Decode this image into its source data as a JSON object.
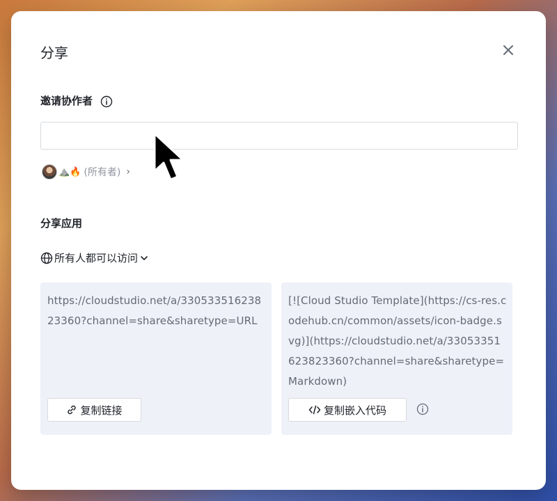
{
  "dialog": {
    "title": "分享",
    "invite": {
      "label": "邀请协作者",
      "input_value": "",
      "owner_emojis": "⛰️🔥",
      "owner_label": "(所有者)",
      "owner_chevron": "›"
    },
    "share_app": {
      "label": "分享应用",
      "access_label": "所有人都可以访问",
      "link_text": "https://cloudstudio.net/a/33053351623823360?channel=share&sharetype=URL",
      "copy_link_label": "复制链接",
      "embed_text": "[![Cloud Studio Template](https://cs-res.codehub.cn/common/assets/icon-badge.svg)](https://cloudstudio.net/a/33053351623823360?channel=share&sharetype=Markdown)",
      "copy_embed_label": "复制嵌入代码"
    }
  },
  "icons": {
    "close": "close-icon",
    "info": "info-icon",
    "globe": "globe-icon",
    "chevron": "chevron-down-icon",
    "link": "link-icon",
    "code": "code-icon"
  },
  "colors": {
    "card_bg": "#eef1f8",
    "text_primary": "#1f2329",
    "text_secondary": "#646a73",
    "border": "#d6d9de"
  }
}
